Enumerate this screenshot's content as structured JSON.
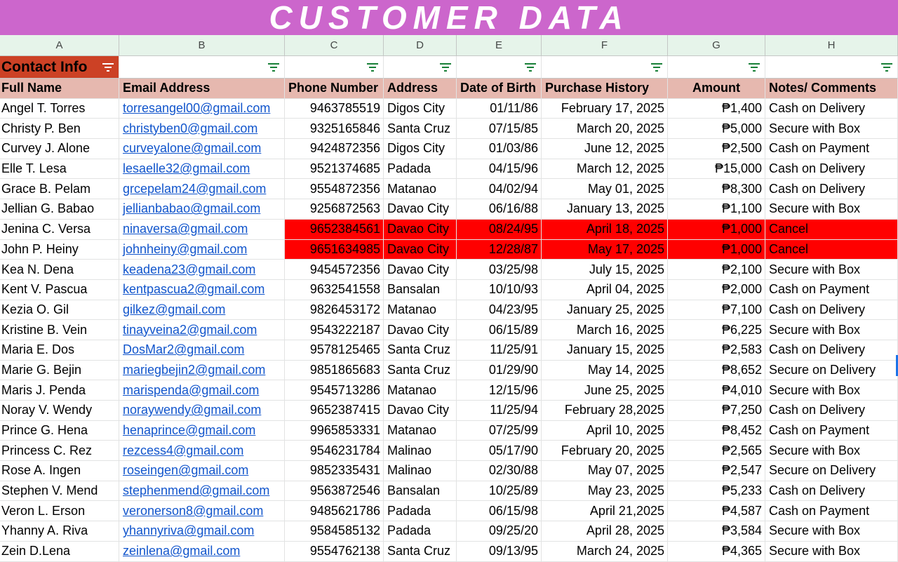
{
  "banner_title": "CUSTOMER DATA",
  "columns": [
    "A",
    "B",
    "C",
    "D",
    "E",
    "F",
    "G",
    "H"
  ],
  "section_title": "Contact Info",
  "headers": [
    "Full Name",
    "Email Address",
    "Phone Number",
    "Address",
    "Date of Birth",
    "Purchase History",
    "Amount",
    "Notes/ Comments"
  ],
  "highlight_color": "#ff0000",
  "rows": [
    {
      "name": "Angel T. Torres",
      "email": "torresangel00@gmail.com",
      "phone": "9463785519",
      "address": "Digos City",
      "dob": "01/11/86",
      "purchase": "February 17, 2025",
      "amount": "₱1,400",
      "notes": "Cash on Delivery",
      "highlight": false
    },
    {
      "name": "Christy P. Ben",
      "email": "christyben0@gmail.com",
      "phone": "9325165846",
      "address": "Santa Cruz",
      "dob": "07/15/85",
      "purchase": "March 20, 2025",
      "amount": "₱5,000",
      "notes": "Secure with Box",
      "highlight": false
    },
    {
      "name": "Curvey J. Alone",
      "email": "curveyalone@gmail.com",
      "phone": "9424872356",
      "address": "Digos City",
      "dob": "01/03/86",
      "purchase": "June 12, 2025",
      "amount": "₱2,500",
      "notes": "Cash on Payment",
      "highlight": false
    },
    {
      "name": "Elle T. Lesa",
      "email": "lesaelle32@gmail.com",
      "phone": "9521374685",
      "address": "Padada",
      "dob": "04/15/96",
      "purchase": "March 12, 2025",
      "amount": "₱15,000",
      "notes": "Cash on Delivery",
      "highlight": false
    },
    {
      "name": "Grace B. Pelam",
      "email": "grcepelam24@gmail.com",
      "phone": "9554872356",
      "address": "Matanao",
      "dob": "04/02/94",
      "purchase": "May 01, 2025",
      "amount": "₱8,300",
      "notes": "Cash on Delivery",
      "highlight": false
    },
    {
      "name": "Jellian G. Babao",
      "email": "jellianbabao@gmail.com",
      "phone": "9256872563",
      "address": "Davao City",
      "dob": "06/16/88",
      "purchase": "January 13, 2025",
      "amount": "₱1,100",
      "notes": "Secure with Box",
      "highlight": false
    },
    {
      "name": "Jenina C. Versa",
      "email": "ninaversa@gmail.com",
      "phone": "9652384561",
      "address": "Davao City",
      "dob": "08/24/95",
      "purchase": "April 18, 2025",
      "amount": "₱1,000",
      "notes": "Cancel",
      "highlight": true
    },
    {
      "name": "John P. Heiny",
      "email": "johnheiny@gmail.com",
      "phone": "9651634985",
      "address": "Davao City",
      "dob": "12/28/87",
      "purchase": "May 17, 2025",
      "amount": "₱1,000",
      "notes": "Cancel",
      "highlight": true
    },
    {
      "name": "Kea N. Dena",
      "email": "keadena23@gmail.com",
      "phone": "9454572356",
      "address": "Davao City",
      "dob": "03/25/98",
      "purchase": "July 15, 2025",
      "amount": "₱2,100",
      "notes": "Secure with Box",
      "highlight": false
    },
    {
      "name": "Kent V. Pascua",
      "email": "kentpascua2@gmail.com",
      "phone": "9632541558",
      "address": "Bansalan",
      "dob": "10/10/93",
      "purchase": "April 04, 2025",
      "amount": "₱2,000",
      "notes": "Cash on Payment",
      "highlight": false
    },
    {
      "name": "Kezia O. Gil",
      "email": "gilkez@gmail.com",
      "phone": "9826453172",
      "address": "Matanao",
      "dob": "04/23/95",
      "purchase": "January 25, 2025",
      "amount": "₱7,100",
      "notes": "Cash on Delivery",
      "highlight": false
    },
    {
      "name": "Kristine B. Vein",
      "email": "tinayveina2@gmail.com",
      "phone": "9543222187",
      "address": "Davao City",
      "dob": "06/15/89",
      "purchase": "March 16, 2025",
      "amount": "₱6,225",
      "notes": "Secure with Box",
      "highlight": false
    },
    {
      "name": "Maria E. Dos",
      "email": "DosMar2@gmail.com",
      "phone": "9578125465",
      "address": "Santa Cruz",
      "dob": "11/25/91",
      "purchase": "January 15, 2025",
      "amount": "₱2,583",
      "notes": "Cash on Delivery",
      "highlight": false
    },
    {
      "name": "Marie G. Bejin",
      "email": "mariegbejin2@gmail.com",
      "phone": "9851865683",
      "address": "Santa Cruz",
      "dob": "01/29/90",
      "purchase": "May 14, 2025",
      "amount": "₱8,652",
      "notes": "Secure on Delivery",
      "highlight": false
    },
    {
      "name": "Maris J. Penda",
      "email": "marispenda@gmail.com",
      "phone": "9545713286",
      "address": "Matanao",
      "dob": "12/15/96",
      "purchase": "June 25, 2025",
      "amount": "₱4,010",
      "notes": "Secure with Box",
      "highlight": false
    },
    {
      "name": "Noray V. Wendy",
      "email": "noraywendy@gmail.com",
      "phone": "9652387415",
      "address": "Davao City",
      "dob": "11/25/94",
      "purchase": "February 28,2025",
      "amount": "₱7,250",
      "notes": "Cash on Delivery",
      "highlight": false
    },
    {
      "name": "Prince G. Hena",
      "email": "henaprince@gmail.com",
      "phone": "9965853331",
      "address": "Matanao",
      "dob": "07/25/99",
      "purchase": "April 10, 2025",
      "amount": "₱8,452",
      "notes": "Cash on Payment",
      "highlight": false
    },
    {
      "name": "Princess C. Rez",
      "email": "rezcess4@gmail.com",
      "phone": "9546231784",
      "address": "Malinao",
      "dob": "05/17/90",
      "purchase": "February 20, 2025",
      "amount": "₱2,565",
      "notes": "Secure with Box",
      "highlight": false
    },
    {
      "name": "Rose A. Ingen",
      "email": "roseingen@gmail.com",
      "phone": "9852335431",
      "address": "Malinao",
      "dob": "02/30/88",
      "purchase": "May 07, 2025",
      "amount": "₱2,547",
      "notes": "Secure on Delivery",
      "highlight": false
    },
    {
      "name": "Stephen V. Mend",
      "email": "stephenmend@gmail.com",
      "phone": "9563872546",
      "address": "Bansalan",
      "dob": "10/25/89",
      "purchase": "May 23, 2025",
      "amount": "₱5,233",
      "notes": "Cash on Delivery",
      "highlight": false
    },
    {
      "name": "Veron L. Erson",
      "email": "veronerson8@gmail.com",
      "phone": "9485621786",
      "address": "Padada",
      "dob": "06/15/98",
      "purchase": "April 21,2025",
      "amount": "₱4,587",
      "notes": "Cash on Payment",
      "highlight": false
    },
    {
      "name": "Yhanny A. Riva",
      "email": "yhannyriva@gmail.com",
      "phone": "9584585132",
      "address": "Padada",
      "dob": "09/25/20",
      "purchase": "April 28, 2025",
      "amount": "₱3,584",
      "notes": "Secure with Box",
      "highlight": false
    },
    {
      "name": "Zein D.Lena",
      "email": "zeinlena@gmail.com",
      "phone": "9554762138",
      "address": "Santa Cruz",
      "dob": "09/13/95",
      "purchase": "March 24, 2025",
      "amount": "₱4,365",
      "notes": "Secure with Box",
      "highlight": false
    }
  ]
}
